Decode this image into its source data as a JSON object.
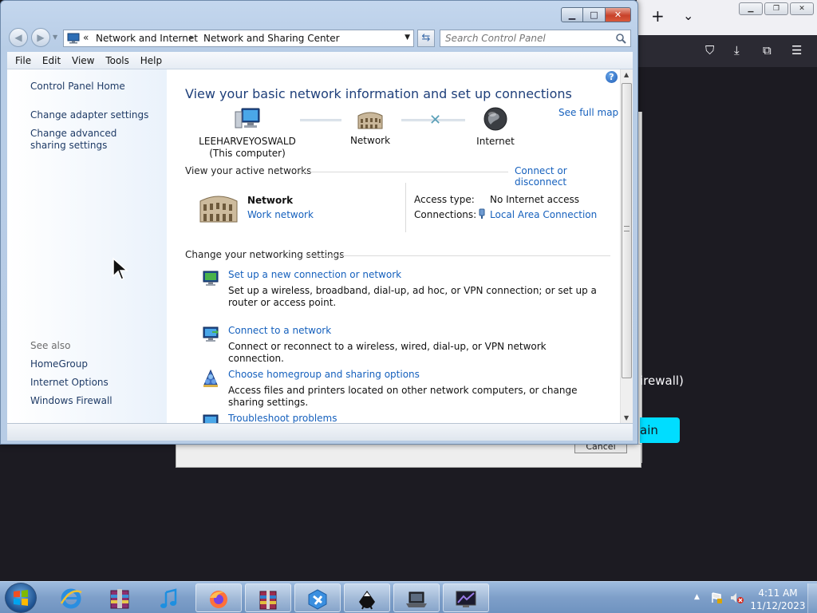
{
  "window": {
    "address": {
      "chevrons": "«",
      "crumb1": "Network and Internet",
      "separator": "▸",
      "crumb2": "Network and Sharing Center"
    },
    "search": {
      "placeholder": "Search Control Panel"
    }
  },
  "menu": {
    "items": [
      "File",
      "Edit",
      "View",
      "Tools",
      "Help"
    ]
  },
  "leftpane": {
    "home": "Control Panel Home",
    "adapter": "Change adapter settings",
    "advanced": "Change advanced sharing settings",
    "see_also": "See also",
    "homegroup": "HomeGroup",
    "internet_options": "Internet Options",
    "firewall": "Windows Firewall"
  },
  "main": {
    "title": "View your basic network information and set up connections",
    "see_full_map": "See full map",
    "map": {
      "computer_name": "LEEHARVEYOSWALD",
      "computer_sub": "(This computer)",
      "network": "Network",
      "internet": "Internet"
    },
    "active_header": "View your active networks",
    "connect_link": "Connect or disconnect",
    "active": {
      "name": "Network",
      "type": "Work network",
      "access_label": "Access type:",
      "access_value": "No Internet access",
      "conn_label": "Connections:",
      "conn_value": "Local Area Connection"
    },
    "change_header": "Change your networking settings",
    "tasks": [
      {
        "link": "Set up a new connection or network",
        "desc": "Set up a wireless, broadband, dial-up, ad hoc, or VPN connection; or set up a router or access point."
      },
      {
        "link": "Connect to a network",
        "desc": "Connect or reconnect to a wireless, wired, dial-up, or VPN network connection."
      },
      {
        "link": "Choose homegroup and sharing options",
        "desc": "Access files and printers located on other network computers, or change sharing settings."
      },
      {
        "link": "Troubleshoot problems",
        "desc": ""
      }
    ]
  },
  "background": {
    "firewall_text": "irewall)",
    "again_button": "ain",
    "cancel_button": "Cancel",
    "new_tab": "+",
    "tab_list": "⌄"
  },
  "taskbar": {
    "clock_time": "4:11 AM",
    "clock_date": "11/12/2023",
    "items": [
      "internet-explorer",
      "winrar-archive",
      "itunes",
      "firefox",
      "winrar",
      "toolbox",
      "inkscape",
      "computer-app",
      "screen-app"
    ]
  },
  "colors": {
    "link": "#1560bd",
    "title": "#1e3f7a",
    "accent_button": "#00ddff"
  }
}
